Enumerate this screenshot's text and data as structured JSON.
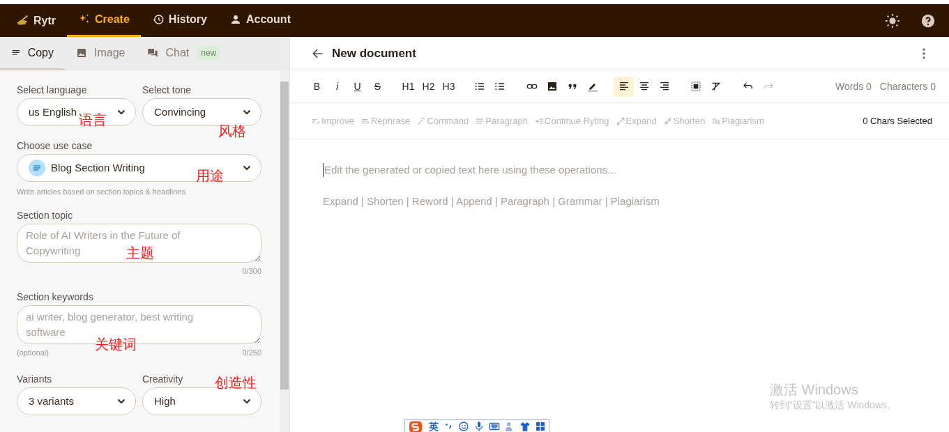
{
  "nav": {
    "brand": "Rytr",
    "items": [
      {
        "label": "Create",
        "selected": true
      },
      {
        "label": "History",
        "selected": false
      },
      {
        "label": "Account",
        "selected": false
      }
    ]
  },
  "panel_tabs": [
    {
      "label": "Copy",
      "selected": true
    },
    {
      "label": "Image",
      "selected": false
    },
    {
      "label": "Chat",
      "selected": false,
      "badge": "new"
    }
  ],
  "form": {
    "language": {
      "label": "Select language",
      "value": "us English"
    },
    "tone": {
      "label": "Select tone",
      "value": "Convincing"
    },
    "use_case": {
      "label": "Choose use case",
      "value": "Blog Section Writing",
      "hint": "Write articles based on section topics & headlines"
    },
    "section_topic": {
      "label": "Section topic",
      "placeholder": "Role of AI Writers in the Future of Copywriting",
      "counter": "0/300"
    },
    "section_keywords": {
      "label": "Section keywords",
      "placeholder": "ai writer, blog generator, best writing software",
      "note": "(optional)",
      "counter": "0/250"
    },
    "variants": {
      "label": "Variants",
      "value": "3 variants"
    },
    "creativity": {
      "label": "Creativity",
      "value": "High"
    }
  },
  "annotations": [
    "语言",
    "风格",
    "用途",
    "主题",
    "关键词",
    "创造性"
  ],
  "document": {
    "title": "New document",
    "format_buttons": [
      "B",
      "i",
      "U",
      "S"
    ],
    "heading_buttons": [
      "H1",
      "H2",
      "H3"
    ],
    "alignment": [
      {
        "selected": true
      },
      {
        "selected": false
      },
      {
        "selected": false
      }
    ],
    "words": "Words 0",
    "characters": "Characters 0",
    "actions": [
      {
        "label": "Improve",
        "disabled": true
      },
      {
        "label": "Rephrase",
        "disabled": true
      },
      {
        "label": "Command",
        "disabled": true
      },
      {
        "label": "Paragraph",
        "disabled": true
      },
      {
        "label": "Continue Ryting",
        "disabled": true
      },
      {
        "label": "Expand",
        "disabled": true
      },
      {
        "label": "Shorten",
        "disabled": true
      },
      {
        "label": "Plagiarism",
        "disabled": true
      }
    ],
    "chars_selected": "0 Chars Selected",
    "placeholder": "Edit the generated or copied text here using these operations...",
    "operations": "Expand | Shorten | Reword | Append | Paragraph | Grammar | Plagiarism"
  },
  "activation": {
    "title": "激活 Windows",
    "subtitle": "转到“设置”以激活 Windows。"
  },
  "ime": {
    "mode": "英"
  }
}
